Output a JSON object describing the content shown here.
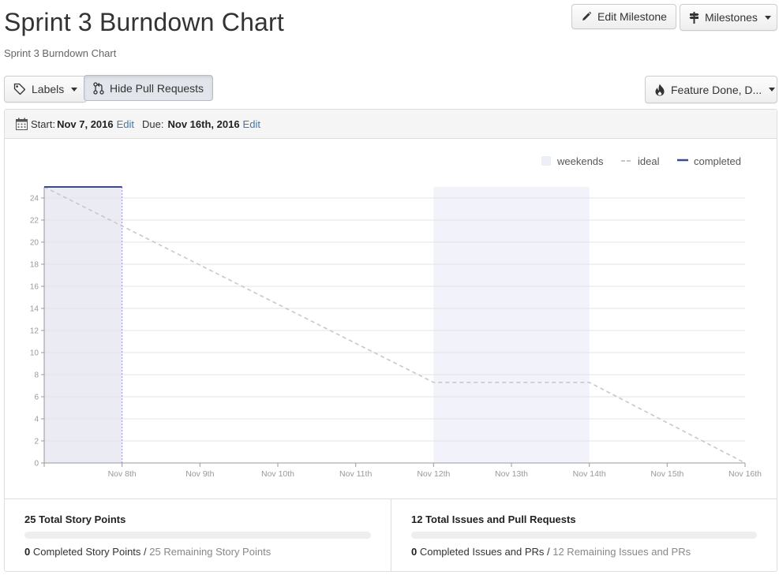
{
  "page": {
    "title": "Sprint 3 Burndown Chart",
    "subtitle": "Sprint 3 Burndown Chart"
  },
  "toolbar": {
    "edit_milestone": "Edit Milestone",
    "milestones": "Milestones",
    "labels": "Labels",
    "hide_pull_requests": "Hide Pull Requests",
    "filter_selected": "Feature Done, D..."
  },
  "dates": {
    "start_label": "Start:",
    "start_value": "Nov 7, 2016",
    "start_edit": "Edit",
    "due_label": "Due:",
    "due_value": "Nov 16th, 2016",
    "due_edit": "Edit"
  },
  "chart_data": {
    "type": "line",
    "x": [
      "Nov 7th",
      "Nov 8th",
      "Nov 9th",
      "Nov 10th",
      "Nov 11th",
      "Nov 12th",
      "Nov 13th",
      "Nov 14th",
      "Nov 15th",
      "Nov 16th"
    ],
    "xticks": [
      "Nov 8th",
      "Nov 9th",
      "Nov 10th",
      "Nov 11th",
      "Nov 12th",
      "Nov 13th",
      "Nov 14th",
      "Nov 15th",
      "Nov 16th"
    ],
    "ylim": [
      0,
      25
    ],
    "yticks": [
      0,
      2,
      4,
      6,
      8,
      10,
      12,
      14,
      16,
      18,
      20,
      22,
      24
    ],
    "grid": true,
    "legend_position": "top-right",
    "legend": [
      "weekends",
      "ideal",
      "completed"
    ],
    "weekends": [
      {
        "from": "Nov 12th",
        "to": "Nov 14th"
      }
    ],
    "today_span": {
      "from": "Nov 7th",
      "to": "Nov 8th"
    },
    "series": [
      {
        "name": "ideal",
        "style": "dashed",
        "x": [
          "Nov 7th",
          "Nov 12th",
          "Nov 14th",
          "Nov 16th"
        ],
        "values": [
          25,
          7.3,
          7.3,
          0
        ]
      },
      {
        "name": "completed",
        "style": "solid",
        "x": [
          "Nov 7th",
          "Nov 8th"
        ],
        "values": [
          25,
          25
        ]
      }
    ],
    "colors": {
      "weekends": "#eceef8",
      "ideal": "#c8c8cc",
      "completed": "#3b4a8c",
      "today": "#ebebf4",
      "today_line": "#9b8be0",
      "grid": "#e3e3e3",
      "axis": "#999999",
      "ticks": "#999999"
    }
  },
  "stats": {
    "points": {
      "title": "25 Total Story Points",
      "completed": "0",
      "completed_label": "Completed Story Points",
      "remaining": "25 Remaining Story Points",
      "progress": 0
    },
    "issues": {
      "title": "12 Total Issues and Pull Requests",
      "completed": "0",
      "completed_label": "Completed Issues and PRs",
      "remaining": "12 Remaining Issues and PRs",
      "progress": 0
    }
  },
  "colors": {
    "link": "#3c78b5",
    "progress_fill": "#4a5a9c"
  }
}
